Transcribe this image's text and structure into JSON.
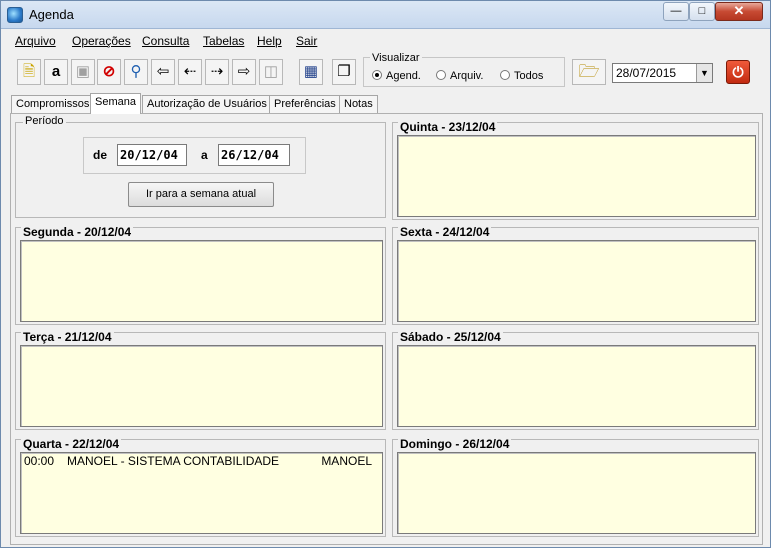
{
  "window": {
    "title": "Agenda"
  },
  "menu": [
    "Arquivo",
    "Operações",
    "Consulta",
    "Tabelas",
    "Help",
    "Sair"
  ],
  "toolbar": {
    "icons": [
      "new-icon",
      "spell-icon",
      "save-icon",
      "cancel-icon",
      "search-icon",
      "first-icon",
      "prev-icon",
      "next-icon",
      "last-icon",
      "delete-icon",
      "calendar-icon",
      "copy-icon",
      "folder-icon",
      "power-icon"
    ],
    "visualizar": {
      "legend": "Visualizar",
      "options": [
        "Agend.",
        "Arquiv.",
        "Todos"
      ],
      "selected": "Agend."
    },
    "date": "28/07/2015"
  },
  "tabs": [
    "Compromissos",
    "Semana",
    "Autorização de Usuários",
    "Preferências",
    "Notas"
  ],
  "active_tab": "Semana",
  "periodo": {
    "legend": "Período",
    "from_label": "de",
    "from": "20/12/04",
    "to_label": "a",
    "to": "26/12/04",
    "button": "Ir para a semana atual"
  },
  "days": {
    "segunda": {
      "title": "Segunda - 20/12/04",
      "entries": []
    },
    "terca": {
      "title": "Terça - 21/12/04",
      "entries": []
    },
    "quarta": {
      "title": "Quarta - 22/12/04",
      "entries": [
        {
          "time": "00:00",
          "desc": "MANOEL - SISTEMA CONTABILIDADE",
          "user": "MANOEL"
        }
      ]
    },
    "quinta": {
      "title": "Quinta - 23/12/04",
      "entries": []
    },
    "sexta": {
      "title": "Sexta - 24/12/04",
      "entries": []
    },
    "sabado": {
      "title": "Sábado - 25/12/04",
      "entries": []
    },
    "domingo": {
      "title": "Domingo - 26/12/04",
      "entries": []
    }
  }
}
